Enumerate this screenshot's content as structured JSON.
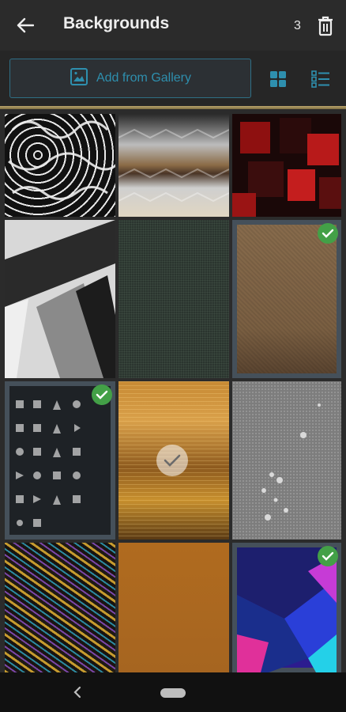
{
  "header": {
    "title": "Backgrounds",
    "selected_count": "3",
    "back_icon": "arrow-back-icon",
    "delete_icon": "trash-icon"
  },
  "toolbar": {
    "add_label": "Add from Gallery",
    "add_icon": "image-icon",
    "grid_view_icon": "grid-view-icon",
    "list_view_icon": "list-view-icon"
  },
  "colors": {
    "accent": "#2e8fae",
    "check_green": "#43a047",
    "divider_gold": "#b9a46b",
    "background": "#2b2b2b"
  },
  "backgrounds": [
    {
      "name": "black-white-swirl-pattern",
      "selected": false
    },
    {
      "name": "metallic-hexagon-tiles",
      "selected": false
    },
    {
      "name": "red-black-squares",
      "selected": false
    },
    {
      "name": "gray-diagonal-stripes",
      "selected": false
    },
    {
      "name": "dark-green-texture",
      "selected": false
    },
    {
      "name": "brown-burlap-texture",
      "selected": true
    },
    {
      "name": "icon-pattern-dark",
      "selected": true
    },
    {
      "name": "golden-sunset-water",
      "selected": false,
      "highlighted": true
    },
    {
      "name": "gray-water-droplets",
      "selected": false
    },
    {
      "name": "rainbow-metal-wires",
      "selected": false
    },
    {
      "name": "orange-brown-gradient",
      "selected": false
    },
    {
      "name": "blue-pink-geometric",
      "selected": true
    }
  ],
  "navigation": {
    "back_icon": "nav-back-icon",
    "home_icon": "nav-home-pill-icon"
  }
}
